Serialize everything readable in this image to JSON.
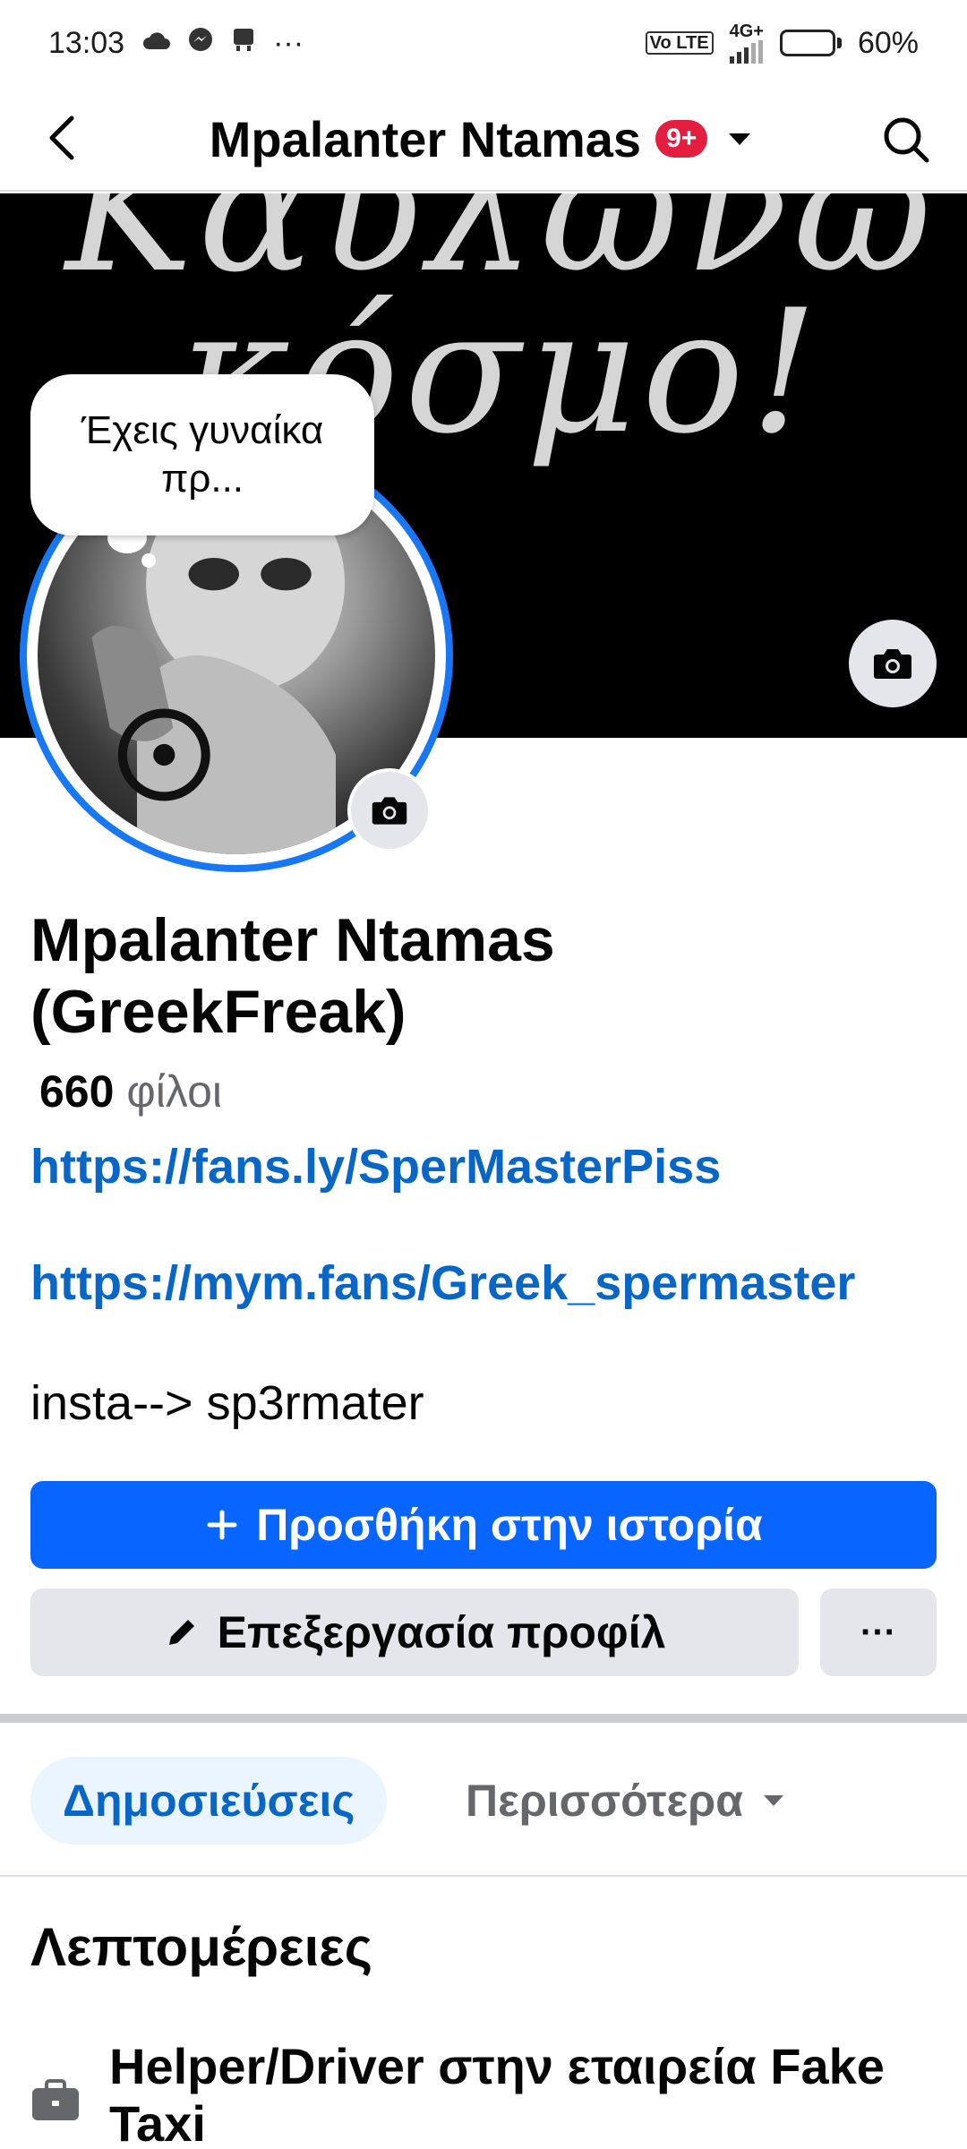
{
  "status_bar": {
    "time": "13:03",
    "more_notifications": "···",
    "volte": "Vo LTE",
    "network": "4G+",
    "battery": "60%",
    "battery_level": 0.6
  },
  "header": {
    "title": "Mpalanter Ntamas",
    "badge": "9+",
    "badge_color": "#e41e3f"
  },
  "cover": {
    "text_line1": "Καυλώνω",
    "text_line2": "κόσμο!"
  },
  "note": {
    "text": "Έχεις γυναίκα πρ..."
  },
  "profile": {
    "name": "Mpalanter Ntamas (GreekFreak)",
    "friends_count": "660",
    "friends_label": "φίλοι",
    "bio_link_1": "https://fans.ly/SperMasterPiss",
    "bio_link_2": "https://mym.fans/Greek_spermaster",
    "bio_text": "insta--> sp3rmater"
  },
  "actions": {
    "add_to_story": "Προσθήκη στην ιστορία",
    "edit_profile": "Επεξεργασία προφίλ",
    "more": "···"
  },
  "tabs": {
    "posts": "Δημοσιεύσεις",
    "more": "Περισσότερα"
  },
  "details": {
    "heading": "Λεπτομέρειες",
    "work": "Helper/Driver στην εταιρεία Fake Taxi"
  },
  "colors": {
    "accent": "#0866ff",
    "link": "#0866c6",
    "ring": "#1877f2",
    "button_grey": "#e4e6eb"
  }
}
